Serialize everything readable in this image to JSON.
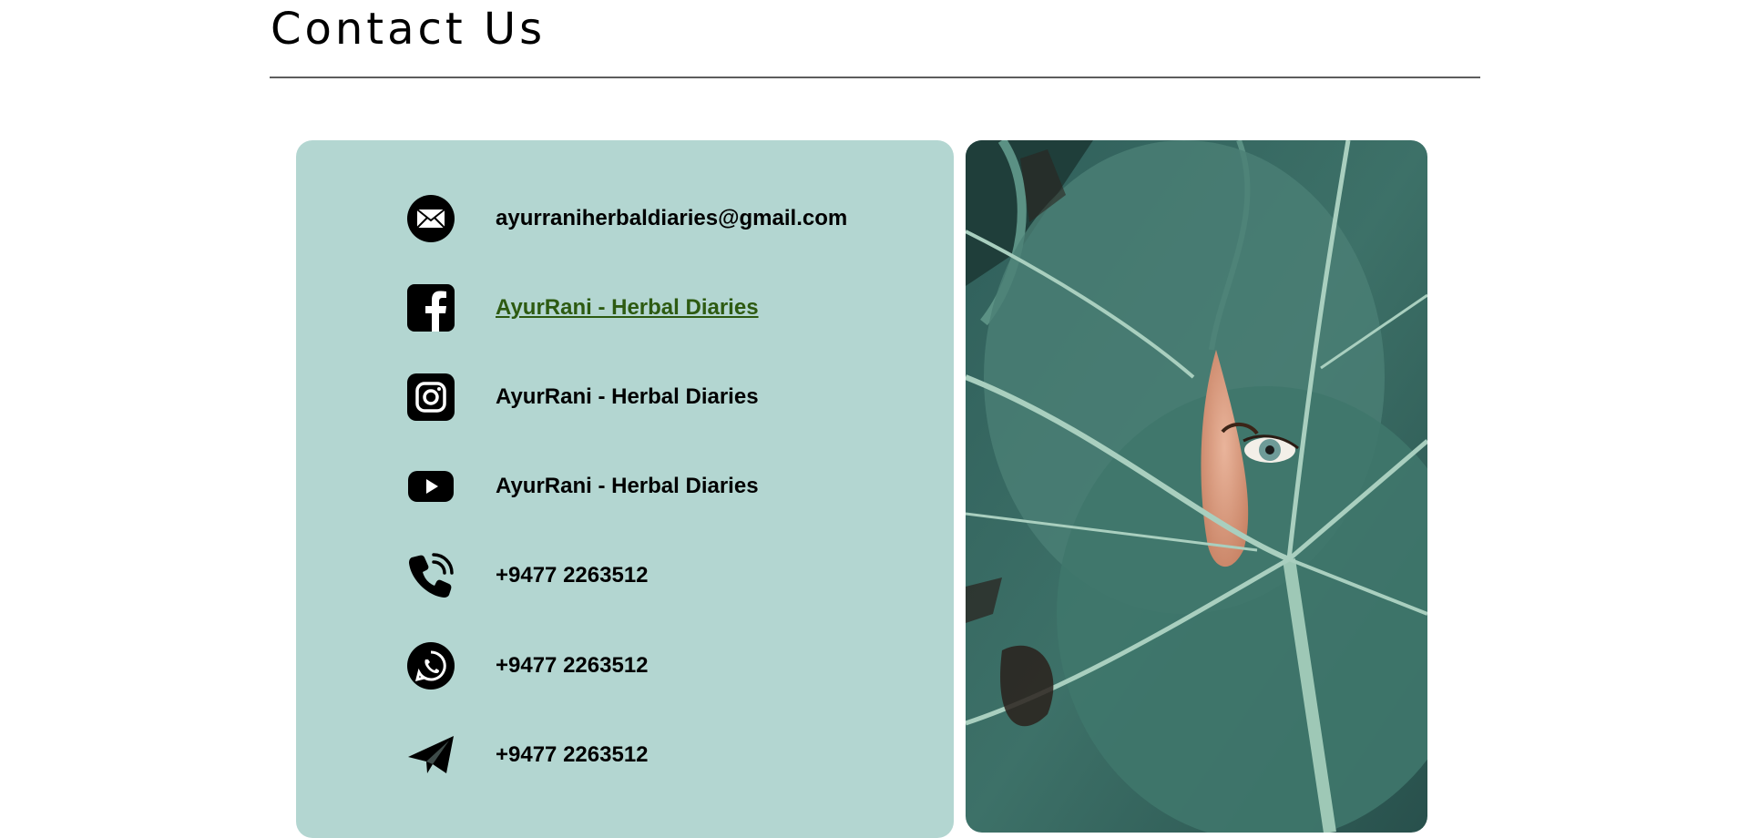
{
  "page": {
    "title": "Contact Us"
  },
  "contacts": [
    {
      "type": "email",
      "icon": "envelope-icon",
      "text": "ayurraniherbaldiaries@gmail.com",
      "is_link": false
    },
    {
      "type": "facebook",
      "icon": "facebook-icon",
      "text": "AyurRani - Herbal Diaries",
      "is_link": true
    },
    {
      "type": "instagram",
      "icon": "instagram-icon",
      "text": "AyurRani - Herbal Diaries",
      "is_link": false
    },
    {
      "type": "youtube",
      "icon": "youtube-icon",
      "text": "AyurRani - Herbal Diaries",
      "is_link": false
    },
    {
      "type": "phone",
      "icon": "phone-icon",
      "text": "+9477 2263512",
      "is_link": false
    },
    {
      "type": "whatsapp",
      "icon": "whatsapp-icon",
      "text": "+9477 2263512",
      "is_link": false
    },
    {
      "type": "telegram",
      "icon": "telegram-icon",
      "text": "+9477 2263512",
      "is_link": false
    }
  ],
  "colors": {
    "card_background": "#b3d6d1",
    "link": "#2d5a11",
    "divider": "#5d5d5d"
  },
  "photo": {
    "subject": "eye peeking through large green monstera leaf"
  }
}
